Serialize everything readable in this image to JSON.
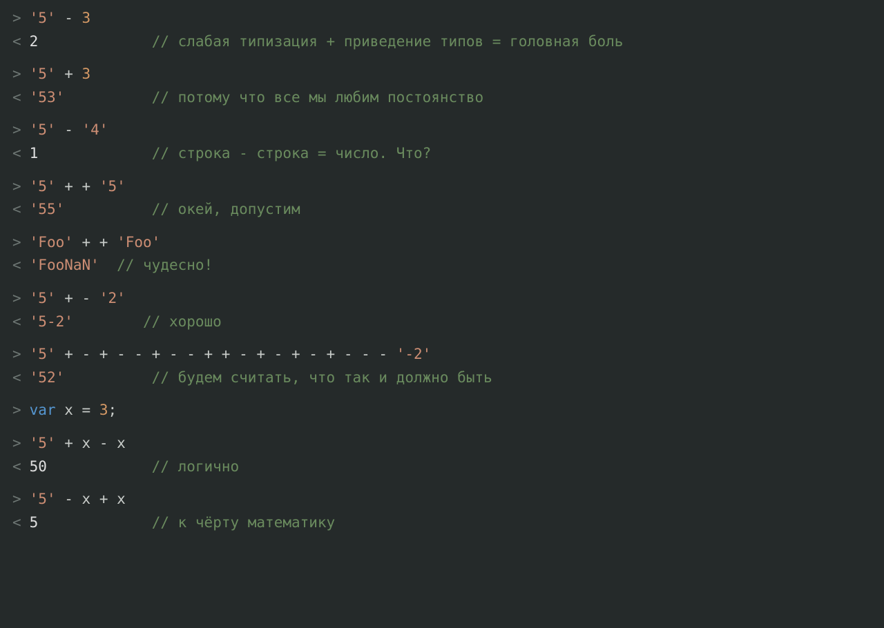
{
  "prompts": {
    "in": ">",
    "out": "<"
  },
  "groups": [
    {
      "rows": [
        {
          "marker": "in",
          "tokens": [
            [
              "str",
              "'5'"
            ],
            [
              "op",
              " - "
            ],
            [
              "num",
              "3"
            ]
          ]
        },
        {
          "marker": "out",
          "tokens": [
            [
              "white",
              "2"
            ]
          ],
          "pad_ch": 13,
          "comment": "// слабая типизация + приведение типов = головная боль"
        }
      ]
    },
    {
      "rows": [
        {
          "marker": "in",
          "tokens": [
            [
              "str",
              "'5'"
            ],
            [
              "op",
              " + "
            ],
            [
              "num",
              "3"
            ]
          ]
        },
        {
          "marker": "out",
          "tokens": [
            [
              "str",
              "'53'"
            ]
          ],
          "pad_ch": 10,
          "comment": "// потому что все мы любим постоянство"
        }
      ]
    },
    {
      "rows": [
        {
          "marker": "in",
          "tokens": [
            [
              "str",
              "'5'"
            ],
            [
              "op",
              " - "
            ],
            [
              "str",
              "'4'"
            ]
          ]
        },
        {
          "marker": "out",
          "tokens": [
            [
              "white",
              "1"
            ]
          ],
          "pad_ch": 13,
          "comment": "// строка - строка = число. Что?"
        }
      ]
    },
    {
      "rows": [
        {
          "marker": "in",
          "tokens": [
            [
              "str",
              "'5'"
            ],
            [
              "op",
              " + + "
            ],
            [
              "str",
              "'5'"
            ]
          ]
        },
        {
          "marker": "out",
          "tokens": [
            [
              "str",
              "'55'"
            ]
          ],
          "pad_ch": 10,
          "comment": "// окей, допустим"
        }
      ]
    },
    {
      "rows": [
        {
          "marker": "in",
          "tokens": [
            [
              "str",
              "'Foo'"
            ],
            [
              "op",
              " + + "
            ],
            [
              "str",
              "'Foo'"
            ]
          ]
        },
        {
          "marker": "out",
          "tokens": [
            [
              "str",
              "'FooNaN'"
            ]
          ],
          "pad_ch": 2,
          "comment": "// чудесно!"
        }
      ]
    },
    {
      "rows": [
        {
          "marker": "in",
          "tokens": [
            [
              "str",
              "'5'"
            ],
            [
              "op",
              " + - "
            ],
            [
              "str",
              "'2'"
            ]
          ]
        },
        {
          "marker": "out",
          "tokens": [
            [
              "str",
              "'5-2'"
            ]
          ],
          "pad_ch": 8,
          "comment": "// хорошо"
        }
      ]
    },
    {
      "rows": [
        {
          "marker": "in",
          "tokens": [
            [
              "str",
              "'5'"
            ],
            [
              "op",
              " + - + - - + - - + + - + - + - + - - - "
            ],
            [
              "str",
              "'-2'"
            ]
          ]
        },
        {
          "marker": "out",
          "tokens": [
            [
              "str",
              "'52'"
            ]
          ],
          "pad_ch": 10,
          "comment": "// будем считать, что так и должно быть"
        }
      ]
    },
    {
      "rows": [
        {
          "marker": "in",
          "tokens": [
            [
              "kw",
              "var"
            ],
            [
              "op",
              " "
            ],
            [
              "id",
              "x"
            ],
            [
              "op",
              " = "
            ],
            [
              "num",
              "3"
            ],
            [
              "semi",
              ";"
            ]
          ]
        }
      ]
    },
    {
      "rows": [
        {
          "marker": "in",
          "tokens": [
            [
              "str",
              "'5'"
            ],
            [
              "op",
              " + "
            ],
            [
              "id",
              "x"
            ],
            [
              "op",
              " - "
            ],
            [
              "id",
              "x"
            ]
          ]
        },
        {
          "marker": "out",
          "tokens": [
            [
              "white",
              "50"
            ]
          ],
          "pad_ch": 12,
          "comment": "// логично"
        }
      ]
    },
    {
      "rows": [
        {
          "marker": "in",
          "tokens": [
            [
              "str",
              "'5'"
            ],
            [
              "op",
              " - "
            ],
            [
              "id",
              "x"
            ],
            [
              "op",
              " + "
            ],
            [
              "id",
              "x"
            ]
          ]
        },
        {
          "marker": "out",
          "tokens": [
            [
              "white",
              "5"
            ]
          ],
          "pad_ch": 13,
          "comment": "// к чёрту математику"
        }
      ]
    }
  ]
}
